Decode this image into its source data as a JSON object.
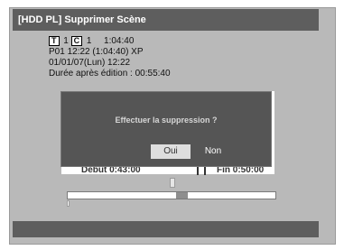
{
  "header": {
    "title": "[HDD PL] Supprimer Scène"
  },
  "info": {
    "title_badge": "T",
    "title_number": "1",
    "chapter_badge": "C",
    "chapter_number": "1",
    "duration": "1:04:40",
    "line2": "P01  12:22 (1:04:40) XP",
    "line3": "01/01/07(Lun)    12:22",
    "line4": "Durée après édition : 00:55:40"
  },
  "markers": {
    "start": "Début  0:43:00",
    "end": "Fin  0:50:00"
  },
  "timeline": {
    "selected_fraction_start": 0.52,
    "selected_fraction_end": 0.58
  },
  "dialog": {
    "message": "Effectuer la suppression ?",
    "yes_label": "Oui",
    "no_label": "Non"
  },
  "colors": {
    "title_bar": "#5e5e5e",
    "screen_bg": "#b9b9b9",
    "dialog_bg": "#555555",
    "selected_button": "#dedede"
  }
}
